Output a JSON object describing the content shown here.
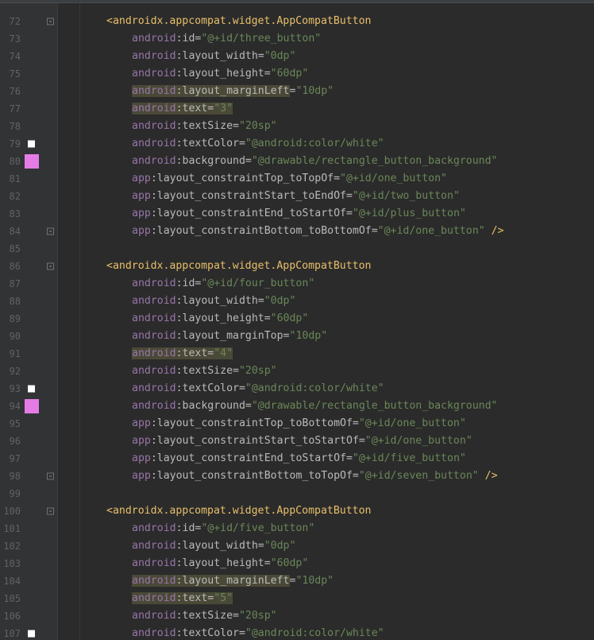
{
  "colors": {
    "background": "#2b2b2b",
    "gutter": "#313335",
    "line_number": "#606366",
    "tag": "#e8bf6a",
    "namespace": "#9876aa",
    "attribute": "#bababa",
    "value": "#6a8759",
    "highlight": "#4a4937",
    "white_marker": "#ffffff",
    "pink_marker": "#e57ce5"
  },
  "icons": {
    "color_swatch": "color-swatch-icon",
    "fold": "fold-marker-icon"
  },
  "editor": {
    "first_visible_line": "71",
    "lines": [
      {
        "num": "72",
        "fold": true,
        "indent": 1,
        "tokens": [
          {
            "t": "<androidx.appcompat.widget.AppCompatButton",
            "c": "tag"
          }
        ]
      },
      {
        "num": "73",
        "indent": 2,
        "tokens": [
          {
            "t": "android",
            "c": "ns"
          },
          {
            "t": ":id=",
            "c": "attr"
          },
          {
            "t": "\"@+id/three_button\"",
            "c": "val"
          }
        ]
      },
      {
        "num": "74",
        "indent": 2,
        "tokens": [
          {
            "t": "android",
            "c": "ns"
          },
          {
            "t": ":layout_width=",
            "c": "attr"
          },
          {
            "t": "\"0dp\"",
            "c": "val"
          }
        ]
      },
      {
        "num": "75",
        "indent": 2,
        "tokens": [
          {
            "t": "android",
            "c": "ns"
          },
          {
            "t": ":layout_height=",
            "c": "attr"
          },
          {
            "t": "\"60dp\"",
            "c": "val"
          }
        ]
      },
      {
        "num": "76",
        "indent": 2,
        "tokens": [
          {
            "t": "android",
            "c": "ns",
            "hl": true
          },
          {
            "t": ":layout_marginLeft",
            "c": "attr",
            "hl": true
          },
          {
            "t": "=",
            "c": "attr"
          },
          {
            "t": "\"10dp\"",
            "c": "val"
          }
        ]
      },
      {
        "num": "77",
        "indent": 2,
        "tokens": [
          {
            "t": "android",
            "c": "ns",
            "hl": true
          },
          {
            "t": ":text=",
            "c": "attr",
            "hl": true
          },
          {
            "t": "\"3\"",
            "c": "val",
            "hl": true
          }
        ]
      },
      {
        "num": "78",
        "indent": 2,
        "tokens": [
          {
            "t": "android",
            "c": "ns"
          },
          {
            "t": ":textSize=",
            "c": "attr"
          },
          {
            "t": "\"20sp\"",
            "c": "val"
          }
        ]
      },
      {
        "num": "79",
        "marker": "white",
        "indent": 2,
        "tokens": [
          {
            "t": "android",
            "c": "ns"
          },
          {
            "t": ":textColor=",
            "c": "attr"
          },
          {
            "t": "\"@android:color/white\"",
            "c": "val"
          }
        ]
      },
      {
        "num": "80",
        "marker": "pink",
        "indent": 2,
        "tokens": [
          {
            "t": "android",
            "c": "ns"
          },
          {
            "t": ":background=",
            "c": "attr"
          },
          {
            "t": "\"@drawable/rectangle_button_background\"",
            "c": "val"
          }
        ]
      },
      {
        "num": "81",
        "indent": 2,
        "tokens": [
          {
            "t": "app",
            "c": "ns"
          },
          {
            "t": ":layout_constraintTop_toTopOf=",
            "c": "attr"
          },
          {
            "t": "\"@+id/one_button\"",
            "c": "val"
          }
        ]
      },
      {
        "num": "82",
        "indent": 2,
        "tokens": [
          {
            "t": "app",
            "c": "ns"
          },
          {
            "t": ":layout_constraintStart_toEndOf=",
            "c": "attr"
          },
          {
            "t": "\"@+id/two_button\"",
            "c": "val"
          }
        ]
      },
      {
        "num": "83",
        "indent": 2,
        "tokens": [
          {
            "t": "app",
            "c": "ns"
          },
          {
            "t": ":layout_constraintEnd_toStartOf=",
            "c": "attr"
          },
          {
            "t": "\"@+id/plus_button\"",
            "c": "val"
          }
        ]
      },
      {
        "num": "84",
        "fold": true,
        "indent": 2,
        "tokens": [
          {
            "t": "app",
            "c": "ns"
          },
          {
            "t": ":layout_constraintBottom_toBottomOf=",
            "c": "attr"
          },
          {
            "t": "\"@+id/one_button\"",
            "c": "val"
          },
          {
            "t": " />",
            "c": "tag"
          }
        ]
      },
      {
        "num": "85",
        "indent": 0,
        "tokens": []
      },
      {
        "num": "86",
        "fold": true,
        "indent": 1,
        "tokens": [
          {
            "t": "<androidx.appcompat.widget.AppCompatButton",
            "c": "tag"
          }
        ]
      },
      {
        "num": "87",
        "indent": 2,
        "tokens": [
          {
            "t": "android",
            "c": "ns"
          },
          {
            "t": ":id=",
            "c": "attr"
          },
          {
            "t": "\"@+id/four_button\"",
            "c": "val"
          }
        ]
      },
      {
        "num": "88",
        "indent": 2,
        "tokens": [
          {
            "t": "android",
            "c": "ns"
          },
          {
            "t": ":layout_width=",
            "c": "attr"
          },
          {
            "t": "\"0dp\"",
            "c": "val"
          }
        ]
      },
      {
        "num": "89",
        "indent": 2,
        "tokens": [
          {
            "t": "android",
            "c": "ns"
          },
          {
            "t": ":layout_height=",
            "c": "attr"
          },
          {
            "t": "\"60dp\"",
            "c": "val"
          }
        ]
      },
      {
        "num": "90",
        "indent": 2,
        "tokens": [
          {
            "t": "android",
            "c": "ns"
          },
          {
            "t": ":layout_marginTop=",
            "c": "attr"
          },
          {
            "t": "\"10dp\"",
            "c": "val"
          }
        ]
      },
      {
        "num": "91",
        "indent": 2,
        "tokens": [
          {
            "t": "android",
            "c": "ns",
            "hl": true
          },
          {
            "t": ":text=",
            "c": "attr",
            "hl": true
          },
          {
            "t": "\"4\"",
            "c": "val",
            "hl": true
          }
        ]
      },
      {
        "num": "92",
        "indent": 2,
        "tokens": [
          {
            "t": "android",
            "c": "ns"
          },
          {
            "t": ":textSize=",
            "c": "attr"
          },
          {
            "t": "\"20sp\"",
            "c": "val"
          }
        ]
      },
      {
        "num": "93",
        "marker": "white",
        "indent": 2,
        "tokens": [
          {
            "t": "android",
            "c": "ns"
          },
          {
            "t": ":textColor=",
            "c": "attr"
          },
          {
            "t": "\"@android:color/white\"",
            "c": "val"
          }
        ]
      },
      {
        "num": "94",
        "marker": "pink",
        "indent": 2,
        "tokens": [
          {
            "t": "android",
            "c": "ns"
          },
          {
            "t": ":background=",
            "c": "attr"
          },
          {
            "t": "\"@drawable/rectangle_button_background\"",
            "c": "val"
          }
        ]
      },
      {
        "num": "95",
        "indent": 2,
        "tokens": [
          {
            "t": "app",
            "c": "ns"
          },
          {
            "t": ":layout_constraintTop_toBottomOf=",
            "c": "attr"
          },
          {
            "t": "\"@+id/one_button\"",
            "c": "val"
          }
        ]
      },
      {
        "num": "96",
        "indent": 2,
        "tokens": [
          {
            "t": "app",
            "c": "ns"
          },
          {
            "t": ":layout_constraintStart_toStartOf=",
            "c": "attr"
          },
          {
            "t": "\"@+id/one_button\"",
            "c": "val"
          }
        ]
      },
      {
        "num": "97",
        "indent": 2,
        "tokens": [
          {
            "t": "app",
            "c": "ns"
          },
          {
            "t": ":layout_constraintEnd_toStartOf=",
            "c": "attr"
          },
          {
            "t": "\"@+id/five_button\"",
            "c": "val"
          }
        ]
      },
      {
        "num": "98",
        "fold": true,
        "indent": 2,
        "tokens": [
          {
            "t": "app",
            "c": "ns"
          },
          {
            "t": ":layout_constraintBottom_toTopOf=",
            "c": "attr"
          },
          {
            "t": "\"@+id/seven_button\"",
            "c": "val"
          },
          {
            "t": " />",
            "c": "tag"
          }
        ]
      },
      {
        "num": "99",
        "indent": 0,
        "tokens": []
      },
      {
        "num": "100",
        "fold": true,
        "indent": 1,
        "tokens": [
          {
            "t": "<androidx.appcompat.widget.AppCompatButton",
            "c": "tag"
          }
        ]
      },
      {
        "num": "101",
        "indent": 2,
        "tokens": [
          {
            "t": "android",
            "c": "ns"
          },
          {
            "t": ":id=",
            "c": "attr"
          },
          {
            "t": "\"@+id/five_button\"",
            "c": "val"
          }
        ]
      },
      {
        "num": "102",
        "indent": 2,
        "tokens": [
          {
            "t": "android",
            "c": "ns"
          },
          {
            "t": ":layout_width=",
            "c": "attr"
          },
          {
            "t": "\"0dp\"",
            "c": "val"
          }
        ]
      },
      {
        "num": "103",
        "indent": 2,
        "tokens": [
          {
            "t": "android",
            "c": "ns"
          },
          {
            "t": ":layout_height=",
            "c": "attr"
          },
          {
            "t": "\"60dp\"",
            "c": "val"
          }
        ]
      },
      {
        "num": "104",
        "indent": 2,
        "tokens": [
          {
            "t": "android",
            "c": "ns",
            "hl": true
          },
          {
            "t": ":layout_marginLeft",
            "c": "attr",
            "hl": true
          },
          {
            "t": "=",
            "c": "attr"
          },
          {
            "t": "\"10dp\"",
            "c": "val"
          }
        ]
      },
      {
        "num": "105",
        "indent": 2,
        "tokens": [
          {
            "t": "android",
            "c": "ns",
            "hl": true
          },
          {
            "t": ":text=",
            "c": "attr",
            "hl": true
          },
          {
            "t": "\"5\"",
            "c": "val",
            "hl": true
          }
        ]
      },
      {
        "num": "106",
        "indent": 2,
        "tokens": [
          {
            "t": "android",
            "c": "ns"
          },
          {
            "t": ":textSize=",
            "c": "attr"
          },
          {
            "t": "\"20sp\"",
            "c": "val"
          }
        ]
      },
      {
        "num": "107",
        "marker": "white",
        "indent": 2,
        "tokens": [
          {
            "t": "android",
            "c": "ns"
          },
          {
            "t": ":textColor=",
            "c": "attr"
          },
          {
            "t": "\"@android:color/white\"",
            "c": "val"
          }
        ]
      }
    ]
  }
}
